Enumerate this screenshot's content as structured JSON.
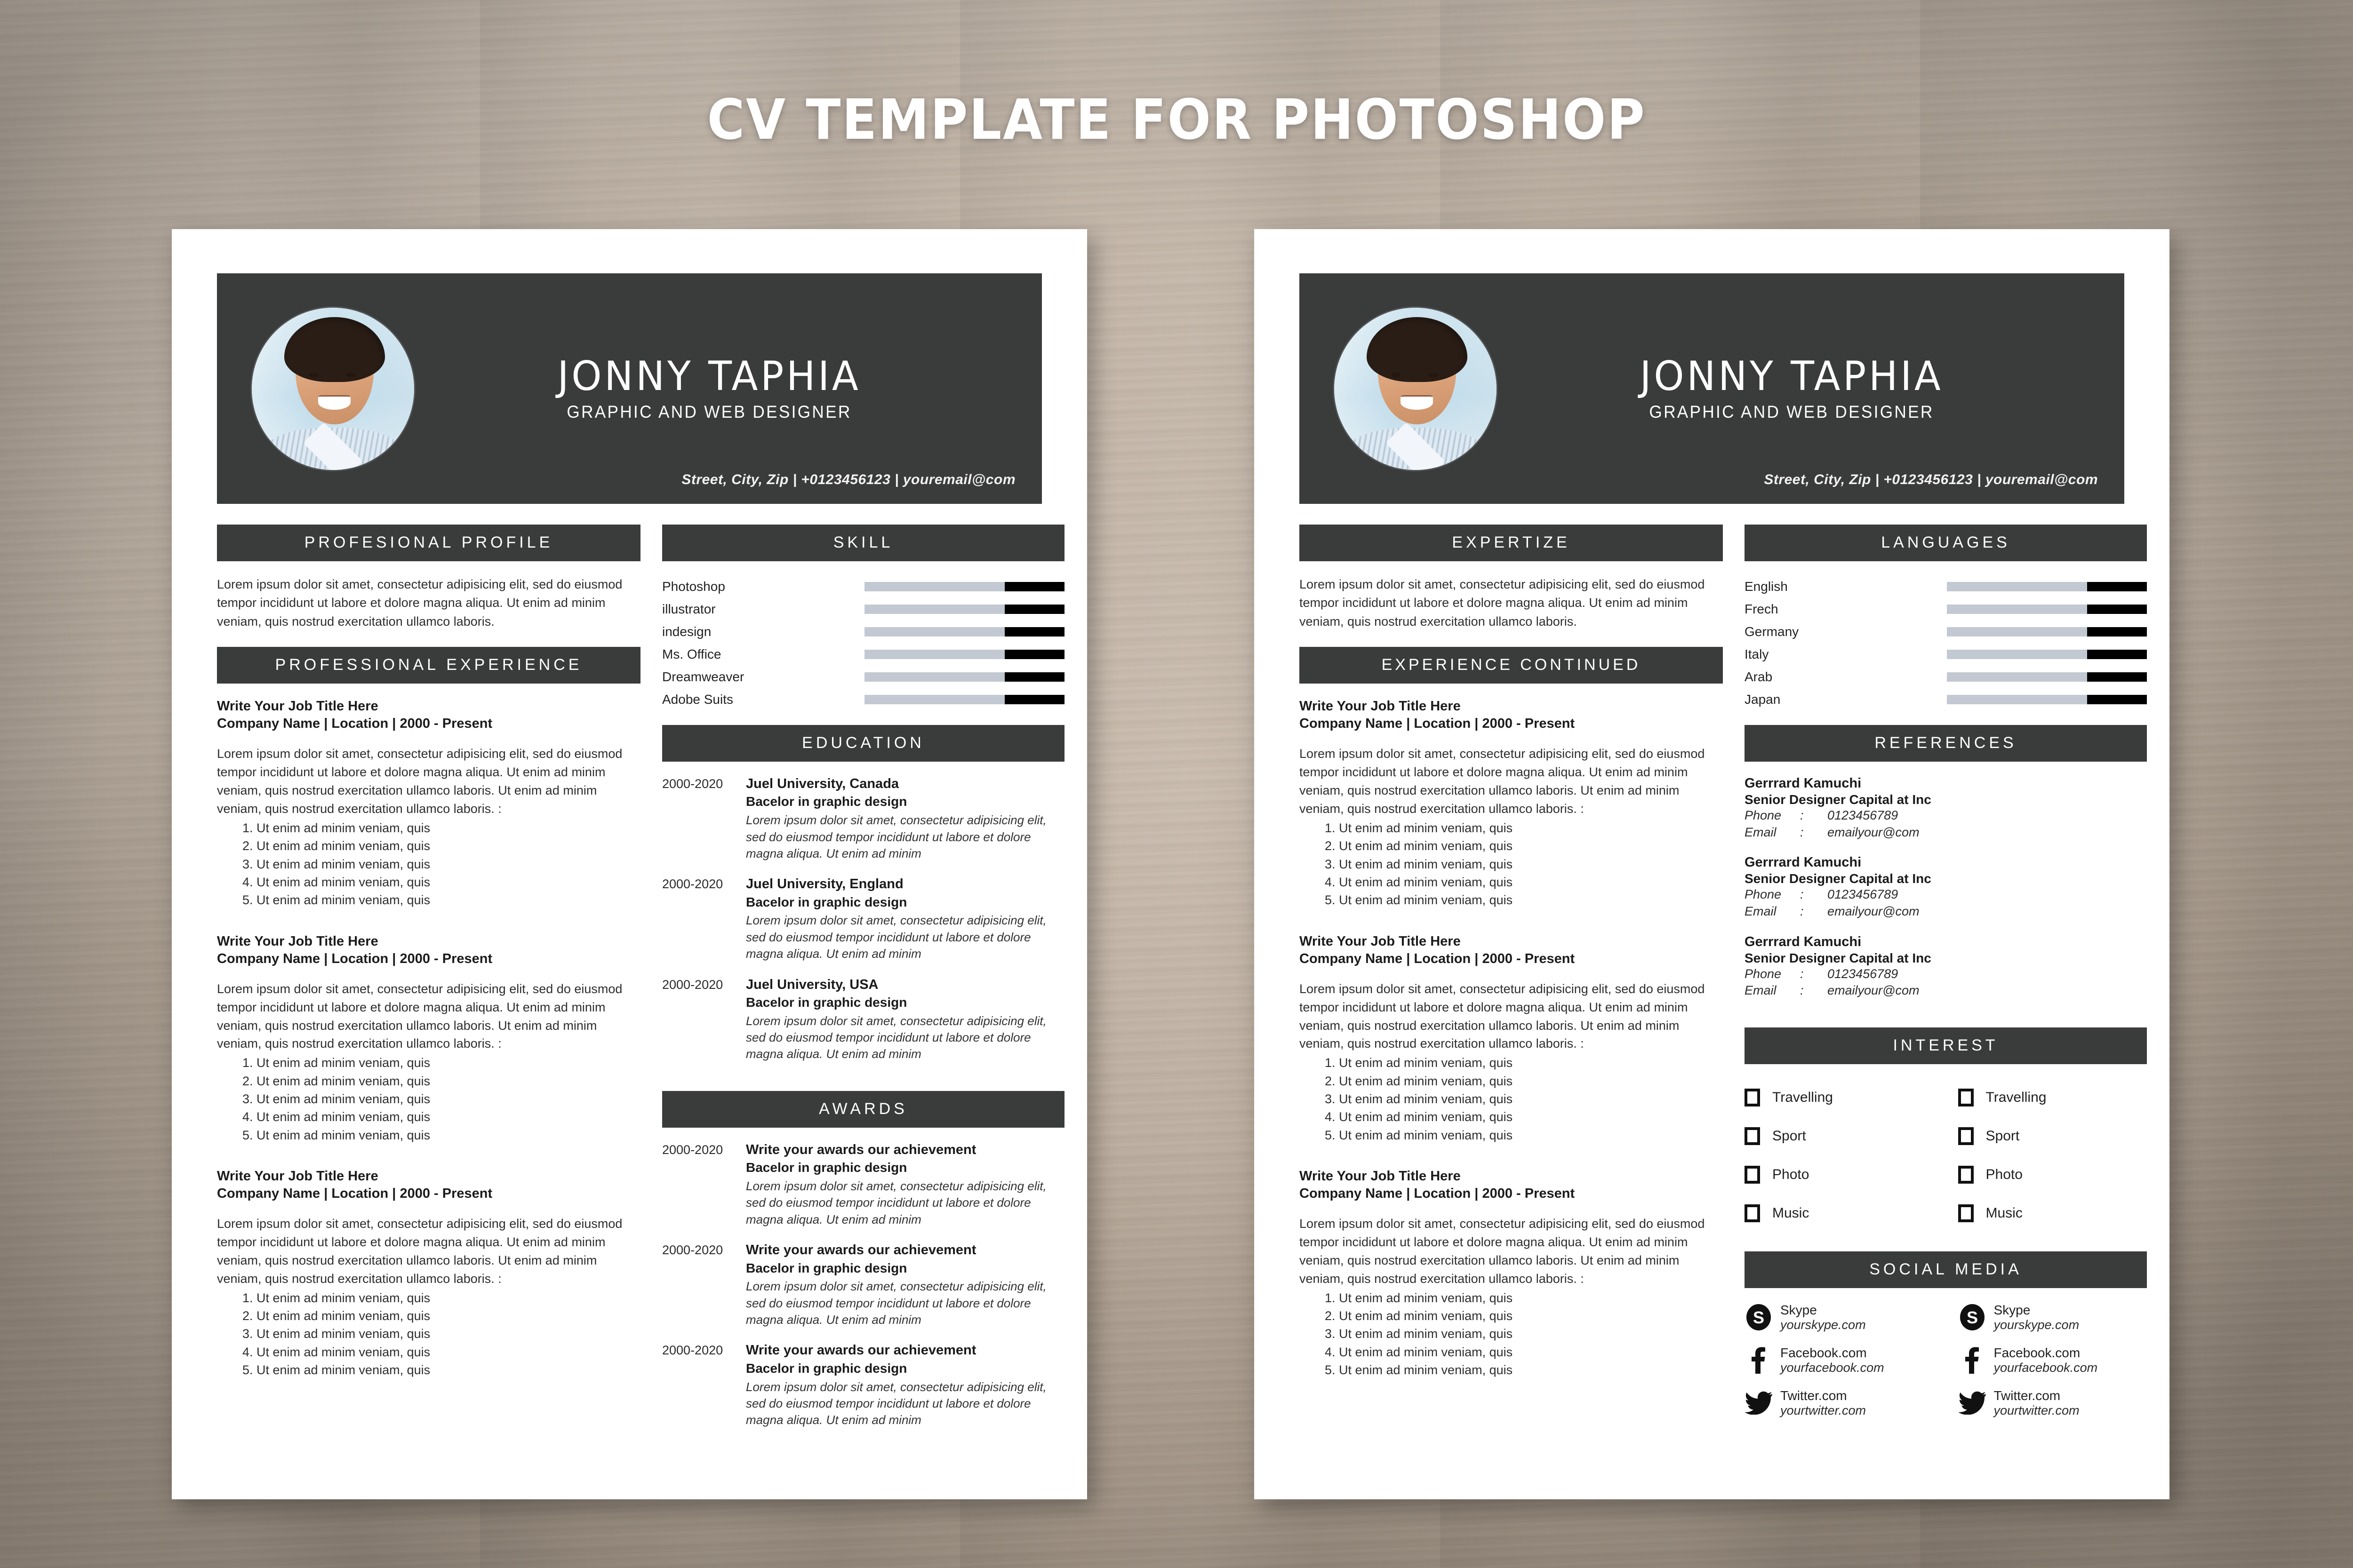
{
  "poster": {
    "headline": "CV TEMPLATE FOR PHOTOSHOP",
    "background_color": "#bfb2a4",
    "accent_dark": "#3a3b3b",
    "bar_gray": "#c3c9d2",
    "bar_black": "#000000"
  },
  "person": {
    "name": "JONNY TAPHIA",
    "role": "GRAPHIC AND WEB DESIGNER",
    "contact": "Street, City, Zip | +0123456123 | youremail@com"
  },
  "headings": {
    "profile": "PROFESIONAL PROFILE",
    "skill": "SKILL",
    "experience": "PROFESSIONAL EXPERIENCE",
    "education": "EDUCATION",
    "awards": "AWARDS",
    "expertize": "EXPERTIZE",
    "languages": "LANGUAGES",
    "experience_continued": "EXPERIENCE CONTINUED",
    "references": "REFERENCES",
    "interest": "INTEREST",
    "social_media": "SOCIAL MEDIA"
  },
  "paragraphs": {
    "profile": "Lorem ipsum dolor sit amet, consectetur adipisicing elit, sed do eiusmod tempor incididunt ut labore et dolore magna aliqua. Ut enim ad minim veniam, quis nostrud exercitation ullamco laboris.",
    "expertize": "Lorem ipsum dolor sit amet, consectetur adipisicing elit, sed do eiusmod tempor incididunt ut labore et dolore magna aliqua. Ut enim ad minim veniam, quis nostrud exercitation ullamco laboris."
  },
  "job": {
    "title": "Write Your Job Title Here",
    "meta": "Company Name | Location | 2000 - Present",
    "desc": "Lorem ipsum dolor sit amet, consectetur adipisicing elit, sed do eiusmod tempor incididunt ut labore et dolore magna aliqua. Ut enim ad minim veniam, quis nostrud exercitation ullamco laboris. Ut enim ad minim veniam, quis nostrud exercitation ullamco laboris. :",
    "bullet": "Ut enim ad minim veniam, quis",
    "bullets": [
      "Ut enim ad minim veniam, quis",
      "Ut enim ad minim veniam, quis",
      "Ut enim ad minim veniam, quis",
      "Ut enim ad minim veniam, quis",
      "Ut enim ad minim veniam, quis"
    ]
  },
  "chart_data": [
    {
      "type": "bar",
      "title": "SKILL",
      "orientation": "horizontal",
      "categories": [
        "Photoshop",
        "illustrator",
        "indesign",
        "Ms. Office",
        "Dreamweaver",
        "Adobe Suits"
      ],
      "values": [
        70,
        70,
        70,
        70,
        70,
        70
      ],
      "xlim": [
        0,
        100
      ],
      "xlabel": "",
      "ylabel": "",
      "filled_color": "#c3c9d2",
      "remainder_color": "#000000",
      "grid": false,
      "legend": "none"
    },
    {
      "type": "bar",
      "title": "LANGUAGES",
      "orientation": "horizontal",
      "categories": [
        "English",
        "Frech",
        "Germany",
        "Italy",
        "Arab",
        "Japan"
      ],
      "values": [
        70,
        70,
        70,
        70,
        70,
        70
      ],
      "xlim": [
        0,
        100
      ],
      "xlabel": "",
      "ylabel": "",
      "filled_color": "#c3c9d2",
      "remainder_color": "#000000",
      "grid": false,
      "legend": "none"
    }
  ],
  "skills": [
    {
      "label": "Photoshop",
      "value": 70
    },
    {
      "label": "illustrator",
      "value": 70
    },
    {
      "label": "indesign",
      "value": 70
    },
    {
      "label": "Ms. Office",
      "value": 70
    },
    {
      "label": "Dreamweaver",
      "value": 70
    },
    {
      "label": "Adobe Suits",
      "value": 70
    }
  ],
  "languages": [
    {
      "label": "English",
      "value": 70
    },
    {
      "label": "Frech",
      "value": 70
    },
    {
      "label": "Germany",
      "value": 70
    },
    {
      "label": "Italy",
      "value": 70
    },
    {
      "label": "Arab",
      "value": 70
    },
    {
      "label": "Japan",
      "value": 70
    }
  ],
  "education": [
    {
      "year": "2000-2020",
      "title": "Juel University, Canada",
      "sub": "Bacelor in graphic design",
      "desc": "Lorem ipsum dolor sit amet, consectetur adipisicing elit, sed do eiusmod tempor incididunt ut labore et dolore magna aliqua. Ut enim ad minim"
    },
    {
      "year": "2000-2020",
      "title": "Juel University, England",
      "sub": "Bacelor in graphic design",
      "desc": "Lorem ipsum dolor sit amet, consectetur adipisicing elit, sed do eiusmod tempor incididunt ut labore et dolore magna aliqua. Ut enim ad minim"
    },
    {
      "year": "2000-2020",
      "title": "Juel University, USA",
      "sub": "Bacelor in graphic design",
      "desc": "Lorem ipsum dolor sit amet, consectetur adipisicing elit, sed do eiusmod tempor incididunt ut labore et dolore magna aliqua. Ut enim ad minim"
    }
  ],
  "awards": [
    {
      "year": "2000-2020",
      "title": "Write your awards our achievement",
      "sub": "Bacelor in graphic design",
      "desc": "Lorem ipsum dolor sit amet, consectetur adipisicing elit, sed do eiusmod tempor incididunt ut labore et dolore magna aliqua. Ut enim ad minim"
    },
    {
      "year": "2000-2020",
      "title": "Write your awards our achievement",
      "sub": "Bacelor in graphic design",
      "desc": "Lorem ipsum dolor sit amet, consectetur adipisicing elit, sed do eiusmod tempor incididunt ut labore et dolore magna aliqua. Ut enim ad minim"
    },
    {
      "year": "2000-2020",
      "title": "Write your awards our achievement",
      "sub": "Bacelor in graphic design",
      "desc": "Lorem ipsum dolor sit amet, consectetur adipisicing elit, sed do eiusmod tempor incididunt ut labore et dolore magna aliqua. Ut enim ad minim"
    }
  ],
  "references": [
    {
      "name": "Gerrrard Kamuchi",
      "role": "Senior Designer Capital at Inc",
      "phone_label": "Phone",
      "phone": "0123456789",
      "email_label": "Email",
      "email": "emailyour@com",
      "colon": ":"
    },
    {
      "name": "Gerrrard Kamuchi",
      "role": "Senior Designer Capital at Inc",
      "phone_label": "Phone",
      "phone": "0123456789",
      "email_label": "Email",
      "email": "emailyour@com",
      "colon": ":"
    },
    {
      "name": "Gerrrard Kamuchi",
      "role": "Senior Designer Capital at Inc",
      "phone_label": "Phone",
      "phone": "0123456789",
      "email_label": "Email",
      "email": "emailyour@com",
      "colon": ":"
    }
  ],
  "interests": {
    "column_a": [
      "Travelling",
      "Sport",
      "Photo",
      "Music"
    ],
    "column_b": [
      "Travelling",
      "Sport",
      "Photo",
      "Music"
    ]
  },
  "social": {
    "column_a": [
      {
        "icon": "skype-icon",
        "name": "Skype",
        "url": "yourskype.com"
      },
      {
        "icon": "facebook-icon",
        "name": "Facebook.com",
        "url": "yourfacebook.com"
      },
      {
        "icon": "twitter-icon",
        "name": "Twitter.com",
        "url": "yourtwitter.com"
      }
    ],
    "column_b": [
      {
        "icon": "skype-icon",
        "name": "Skype",
        "url": "yourskype.com"
      },
      {
        "icon": "facebook-icon",
        "name": "Facebook.com",
        "url": "yourfacebook.com"
      },
      {
        "icon": "twitter-icon",
        "name": "Twitter.com",
        "url": "yourtwitter.com"
      }
    ]
  }
}
